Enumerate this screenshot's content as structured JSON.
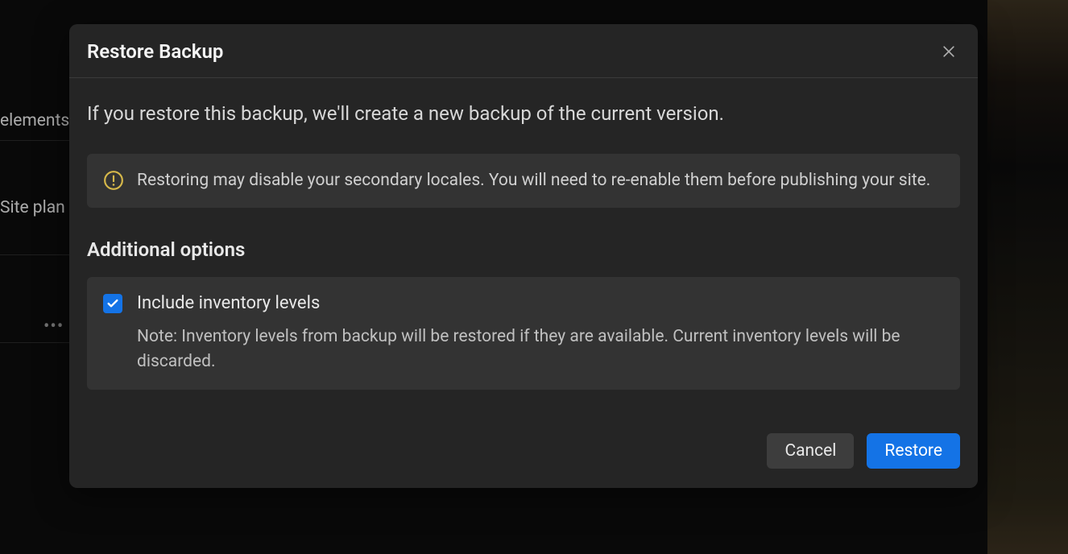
{
  "background": {
    "elements_text": "elements",
    "siteplan_text": "Site plan",
    "more_dots": "•••"
  },
  "modal": {
    "title": "Restore Backup",
    "description": "If you restore this backup, we'll create a new backup of the current version.",
    "warning": "Restoring may disable your secondary locales. You will need to re-enable them before publishing your site.",
    "section_heading": "Additional options",
    "option": {
      "checked": true,
      "label": "Include inventory levels",
      "note": "Note: Inventory levels from backup will be restored if they are available. Current inventory levels will be discarded."
    },
    "buttons": {
      "cancel": "Cancel",
      "restore": "Restore"
    }
  }
}
